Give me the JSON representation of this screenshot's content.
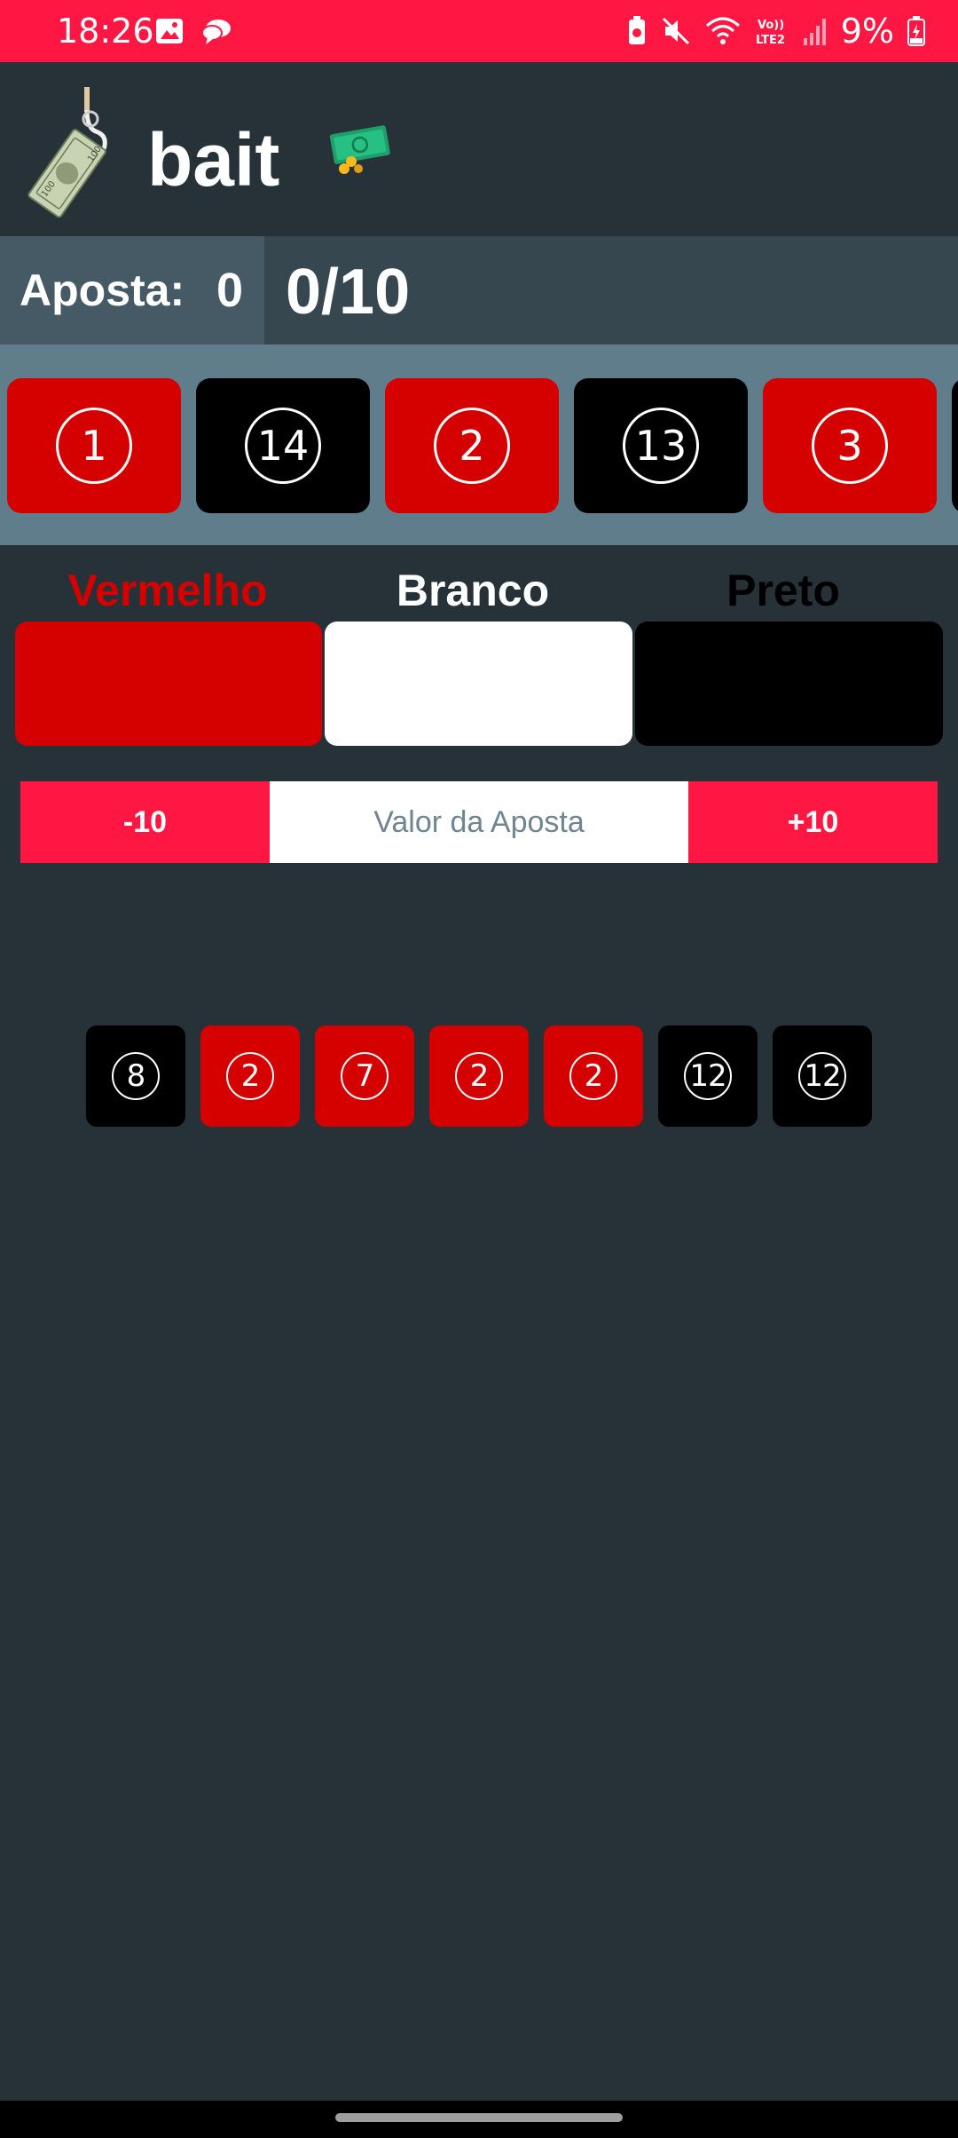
{
  "status_bar": {
    "time": "18:26",
    "battery_percent": "9%",
    "icons_left": [
      "image-icon",
      "chat-bubble-icon"
    ],
    "icons_right": [
      "battery-saver-icon",
      "mute-icon",
      "wifi-icon",
      "volte-icon",
      "signal-icon",
      "battery-icon"
    ]
  },
  "header": {
    "title": "bait"
  },
  "bet_info": {
    "label": "Aposta:",
    "value": "0",
    "progress": "0/10"
  },
  "spin_track": {
    "tiles": [
      {
        "number": "1",
        "color": "red"
      },
      {
        "number": "14",
        "color": "black"
      },
      {
        "number": "2",
        "color": "red"
      },
      {
        "number": "13",
        "color": "black"
      },
      {
        "number": "3",
        "color": "red"
      }
    ]
  },
  "color_choices": [
    {
      "label": "Vermelho",
      "label_color": "#d50000",
      "swatch": "#d50000"
    },
    {
      "label": "Branco",
      "label_color": "#ffffff",
      "swatch": "#ffffff"
    },
    {
      "label": "Preto",
      "label_color": "#000000",
      "swatch": "#000000"
    }
  ],
  "bet_amount": {
    "minus_label": "-10",
    "plus_label": "+10",
    "placeholder": "Valor da Aposta"
  },
  "history": [
    {
      "number": "8",
      "color": "black"
    },
    {
      "number": "2",
      "color": "red"
    },
    {
      "number": "7",
      "color": "red"
    },
    {
      "number": "2",
      "color": "red"
    },
    {
      "number": "2",
      "color": "red"
    },
    {
      "number": "12",
      "color": "black"
    },
    {
      "number": "12",
      "color": "black"
    }
  ],
  "colors": {
    "accent": "#ff1744",
    "background": "#263238",
    "red": "#d50000"
  }
}
